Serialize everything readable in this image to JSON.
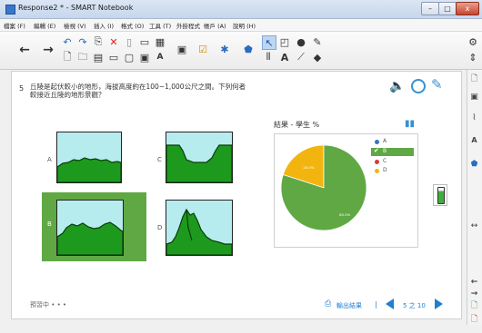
{
  "window": {
    "title": "Response2 * - SMART Notebook",
    "min_label": "–",
    "max_label": "□",
    "close_label": "x"
  },
  "menu": {
    "items": [
      "檔案 (F)",
      "編輯 (E)",
      "檢視 (V)",
      "插入 (I)",
      "格式 (O)",
      "工具 (T)",
      "外掛程式",
      "帳戶 (A)",
      "說明 (H)"
    ]
  },
  "question": {
    "number": "5",
    "text": "丘陵是起伏較小的地形，海拔高度約在100~1,000公尺之間。下列何者較接近丘陵的地形景觀？",
    "options": [
      {
        "label": "A"
      },
      {
        "label": "B"
      },
      {
        "label": "C"
      },
      {
        "label": "D"
      }
    ]
  },
  "results": {
    "title": "結果 - 學生 %",
    "legend": [
      {
        "label": "A",
        "color": "#3a6fc4",
        "selected": false
      },
      {
        "label": "B",
        "color": "#5fa844",
        "selected": true
      },
      {
        "label": "C",
        "color": "#d93a2b",
        "selected": false
      },
      {
        "label": "D",
        "color": "#f2b50f",
        "selected": false
      }
    ]
  },
  "chart_data": {
    "type": "pie",
    "title": "結果 - 學生 %",
    "categories": [
      "A",
      "B",
      "C",
      "D"
    ],
    "values": [
      0,
      80.0,
      0,
      20.0
    ],
    "labels": [
      "",
      "80.0%",
      "",
      "20.0%"
    ],
    "colors": [
      "#3a6fc4",
      "#5fa844",
      "#d93a2b",
      "#f2b50f"
    ]
  },
  "footer": {
    "status": "預習中 • • •",
    "export_label": "輸出結果",
    "separator": "|",
    "page_text": "5 之 10"
  }
}
